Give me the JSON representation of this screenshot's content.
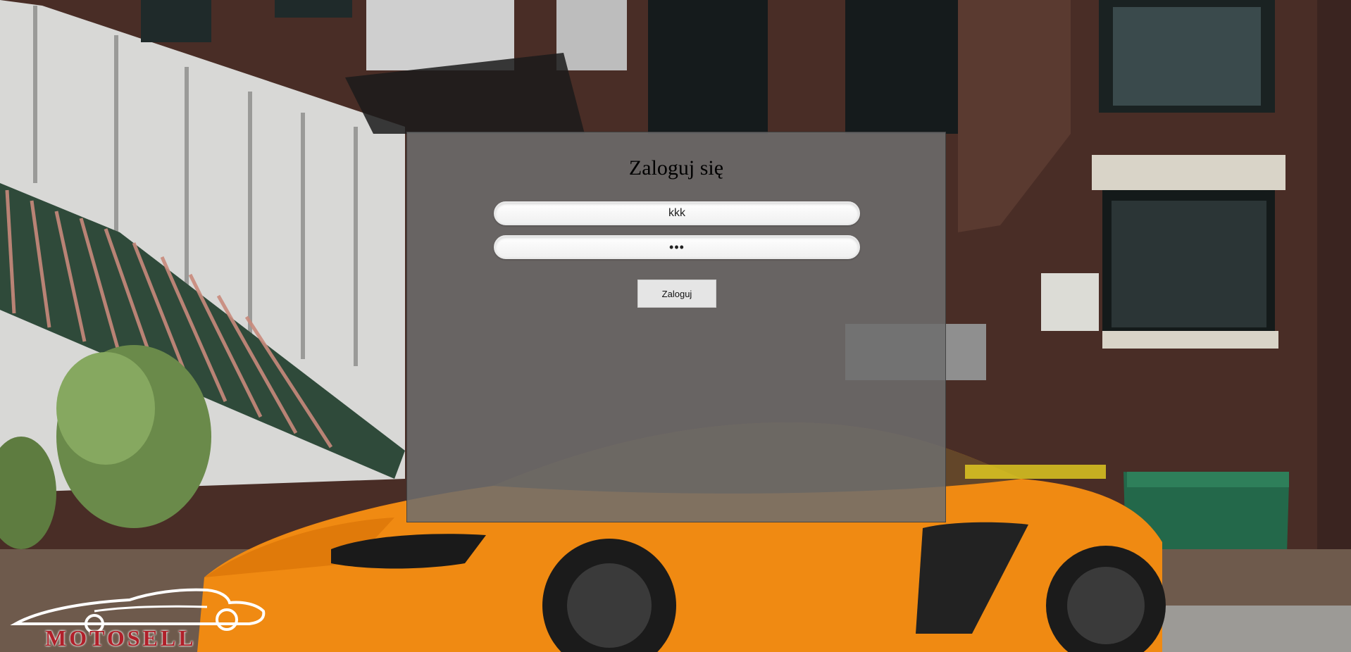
{
  "login": {
    "title": "Zaloguj się",
    "login_value": "kkk",
    "password_value": "•••",
    "submit_label": "Zaloguj"
  },
  "logo": {
    "text": "MOTOSELL"
  },
  "colors": {
    "panel_overlay": "#6e6e6e",
    "car_orange": "#f08a12",
    "brick": "#4a2e26",
    "logo_red": "#b0202a"
  }
}
